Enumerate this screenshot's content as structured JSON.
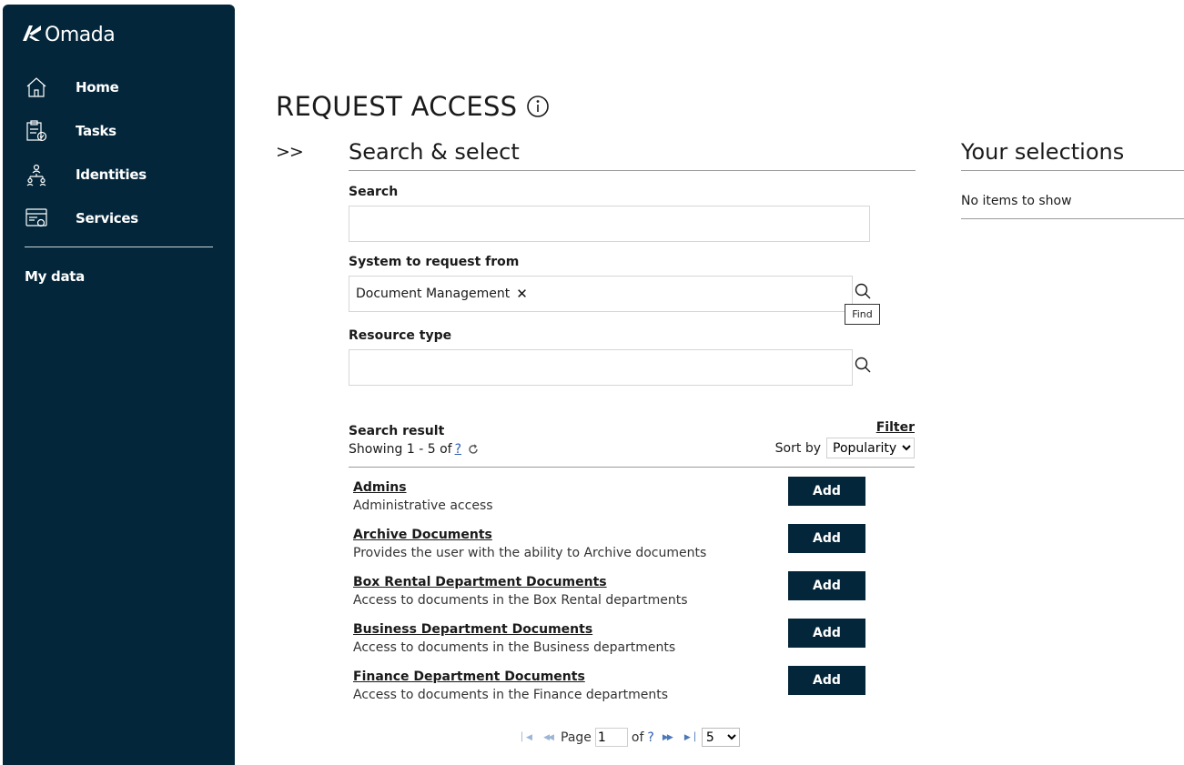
{
  "sidebar": {
    "brand": "Omada",
    "items": [
      {
        "label": "Home",
        "icon": "home-icon"
      },
      {
        "label": "Tasks",
        "icon": "clipboard-check-icon"
      },
      {
        "label": "Identities",
        "icon": "org-chart-icon"
      },
      {
        "label": "Services",
        "icon": "service-card-icon"
      }
    ],
    "my_data": "My data",
    "background": "#03263a"
  },
  "page": {
    "title": "REQUEST ACCESS",
    "collapse_toggle": ">>"
  },
  "search_select": {
    "title": "Search & select",
    "search_label": "Search",
    "search_value": "",
    "system_label": "System to request from",
    "system_chip": "Document Management",
    "system_chip_remove": "✕",
    "find_tooltip": "Find",
    "resource_type_label": "Resource type",
    "resource_type_value": ""
  },
  "results": {
    "heading": "Search result",
    "showing_prefix": "Showing 1 - 5 of",
    "showing_total": "?",
    "filter_label": "Filter",
    "sort_label": "Sort by",
    "sort_selected": "Popularity",
    "add_label": "Add",
    "items": [
      {
        "name": "Admins",
        "description": "Administrative access"
      },
      {
        "name": "Archive Documents",
        "description": "Provides the user with the ability to Archive documents"
      },
      {
        "name": "Box Rental Department Documents",
        "description": "Access to documents in the Box Rental departments"
      },
      {
        "name": "Business Department Documents",
        "description": "Access to documents in the Business departments"
      },
      {
        "name": "Finance Department Documents",
        "description": "Access to documents in the Finance departments"
      }
    ]
  },
  "pager": {
    "page_label": "Page",
    "page_value": "1",
    "of_label": "of",
    "total_pages": "?",
    "page_size": "5"
  },
  "selections": {
    "title": "Your selections",
    "empty_text": "No items to show"
  },
  "colors": {
    "accent": "#03263a",
    "link": "#2a5db0"
  }
}
